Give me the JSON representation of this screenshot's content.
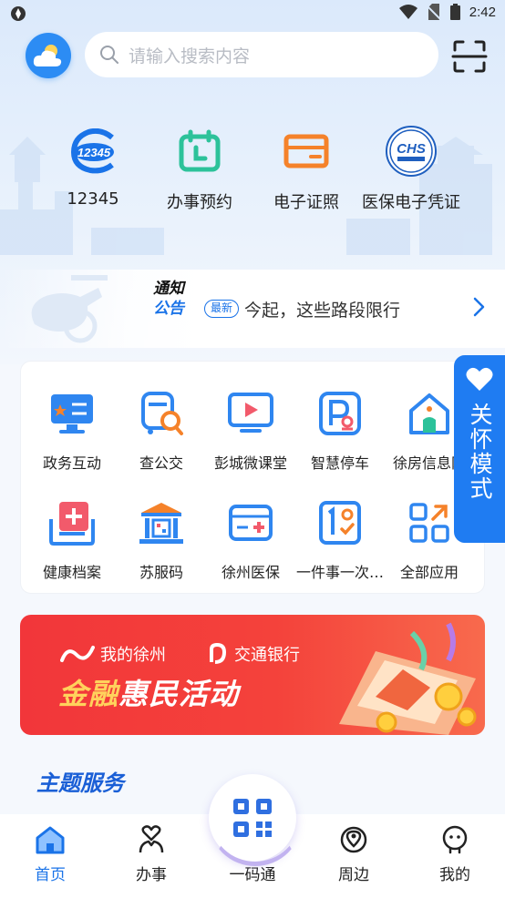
{
  "status_bar": {
    "time": "2:42",
    "icons": [
      "app-status-icon",
      "wifi-icon",
      "no-sim-icon",
      "battery-icon"
    ]
  },
  "header": {
    "logo_icon": "cloud-sun-icon",
    "search_placeholder": "请输入搜索内容",
    "scan_icon": "scan-icon"
  },
  "quick_services": [
    {
      "label": "12345",
      "icon": "hotline-12345-icon"
    },
    {
      "label": "办事预约",
      "icon": "calendar-icon"
    },
    {
      "label": "电子证照",
      "icon": "card-icon"
    },
    {
      "label": "医保电子凭证",
      "icon": "chs-medical-insurance-icon"
    }
  ],
  "notice": {
    "title_line1": "通知",
    "title_line2": "公告",
    "badge": "最新",
    "text": "今起，这些路段限行"
  },
  "services": [
    {
      "label": "政务互动",
      "icon": "monitor-exchange-icon"
    },
    {
      "label": "查公交",
      "icon": "bus-search-icon"
    },
    {
      "label": "彭城微课堂",
      "icon": "video-play-icon"
    },
    {
      "label": "智慧停车",
      "icon": "parking-icon"
    },
    {
      "label": "徐房信息网",
      "icon": "house-icon"
    },
    {
      "label": "健康档案",
      "icon": "medical-box-icon"
    },
    {
      "label": "苏服码",
      "icon": "government-building-icon"
    },
    {
      "label": "徐州医保",
      "icon": "medical-card-icon"
    },
    {
      "label": "一件事一次…",
      "icon": "one-thing-icon"
    },
    {
      "label": "全部应用",
      "icon": "all-apps-icon"
    }
  ],
  "care_mode": {
    "label": "关怀模式",
    "icon": "heart-icon"
  },
  "banner": {
    "brand1": "我的徐州",
    "brand2": "交通银行",
    "slogan_gold": "金融",
    "slogan_white": "惠民活动"
  },
  "theme_section": {
    "title": "主题服务"
  },
  "bottom_nav": [
    {
      "label": "首页",
      "icon": "home-icon",
      "active": true
    },
    {
      "label": "办事",
      "icon": "handshake-heart-icon",
      "active": false
    },
    {
      "label": "一码通",
      "icon": "qr-code-icon",
      "active": false
    },
    {
      "label": "周边",
      "icon": "location-map-icon",
      "active": false
    },
    {
      "label": "我的",
      "icon": "user-face-icon",
      "active": false
    }
  ],
  "colors": {
    "primary": "#1a73e8",
    "care_bg": "#1f7cf2",
    "banner_red": "#f2363a",
    "banner_gold": "#ffd25c",
    "theme_title": "#1a5fd6",
    "icon_orange": "#f5822a",
    "icon_green": "#2cc29a"
  }
}
